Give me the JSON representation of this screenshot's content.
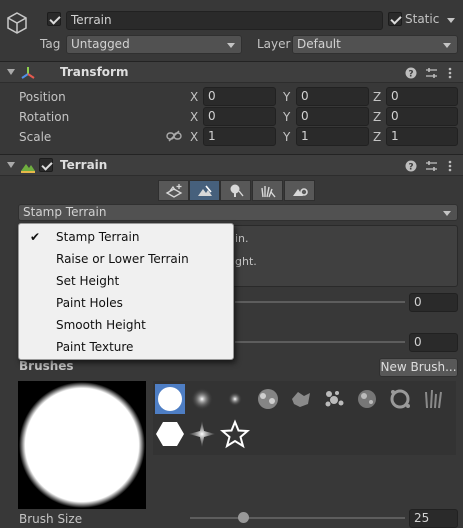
{
  "gameobject": {
    "name": "Terrain",
    "static_label": "Static",
    "tag_label": "Tag",
    "tag_value": "Untagged",
    "layer_label": "Layer",
    "layer_value": "Default"
  },
  "transform": {
    "title": "Transform",
    "position_label": "Position",
    "rotation_label": "Rotation",
    "scale_label": "Scale",
    "axes": [
      "X",
      "Y",
      "Z"
    ],
    "position": [
      "0",
      "0",
      "0"
    ],
    "rotation": [
      "0",
      "0",
      "0"
    ],
    "scale": [
      "1",
      "1",
      "1"
    ]
  },
  "terrain": {
    "title": "Terrain",
    "tools": [
      "create-neighbor-icon",
      "paint-terrain-icon",
      "paint-trees-icon",
      "paint-details-icon",
      "terrain-settings-icon"
    ],
    "tool_dropdown_value": "Stamp Terrain",
    "help_line1_partial": "in.",
    "help_line2_partial": "ght.",
    "slider1_value": "0",
    "slider2_value": "0"
  },
  "menu": {
    "items": [
      "Stamp Terrain",
      "Raise or Lower Terrain",
      "Set Height",
      "Paint Holes",
      "Smooth Height",
      "Paint Texture"
    ],
    "checked_index": 0
  },
  "brushes": {
    "label": "Brushes",
    "new_brush_button": "New Brush...",
    "brush_size_label": "Brush Size",
    "brush_size_value": "25",
    "brush_size_fraction": 0.25
  },
  "colors": {
    "accent": "#46607c",
    "selected_brush_border": "#4e7ec4"
  }
}
